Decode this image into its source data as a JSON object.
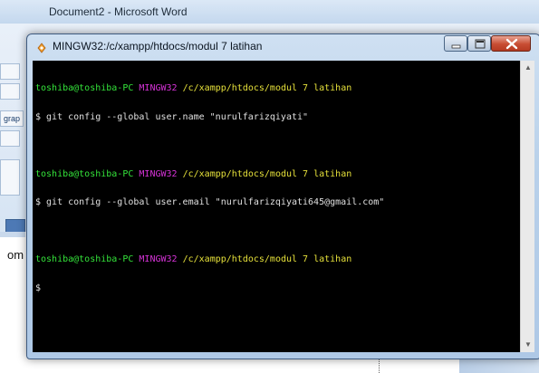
{
  "background_window": {
    "title": "Document2 - Microsoft Word",
    "ribbon_fragment": "grap",
    "page_text_fragment": "om"
  },
  "terminal_window": {
    "title": "MINGW32:/c/xampp/htdocs/modul 7 latihan",
    "icon": "mingw-git-icon",
    "controls": [
      "minimize-icon",
      "maximize-icon",
      "close-icon"
    ],
    "colors": {
      "background": "#000000",
      "user": "#34e33a",
      "system": "#d533d6",
      "path": "#e5e03a",
      "command": "#e0e0e0"
    },
    "prompts": [
      {
        "user": "toshiba@toshiba-PC",
        "system": "MINGW32",
        "path": "/c/xampp/htdocs/modul 7 latihan",
        "command": "$ git config --global user.name \"nurulfarizqiyati\""
      },
      {
        "user": "toshiba@toshiba-PC",
        "system": "MINGW32",
        "path": "/c/xampp/htdocs/modul 7 latihan",
        "command": "$ git config --global user.email \"nurulfarizqiyati645@gmail.com\""
      },
      {
        "user": "toshiba@toshiba-PC",
        "system": "MINGW32",
        "path": "/c/xampp/htdocs/modul 7 latihan",
        "command": "$"
      }
    ],
    "scroll_up_glyph": "▲",
    "scroll_down_glyph": "▼"
  }
}
